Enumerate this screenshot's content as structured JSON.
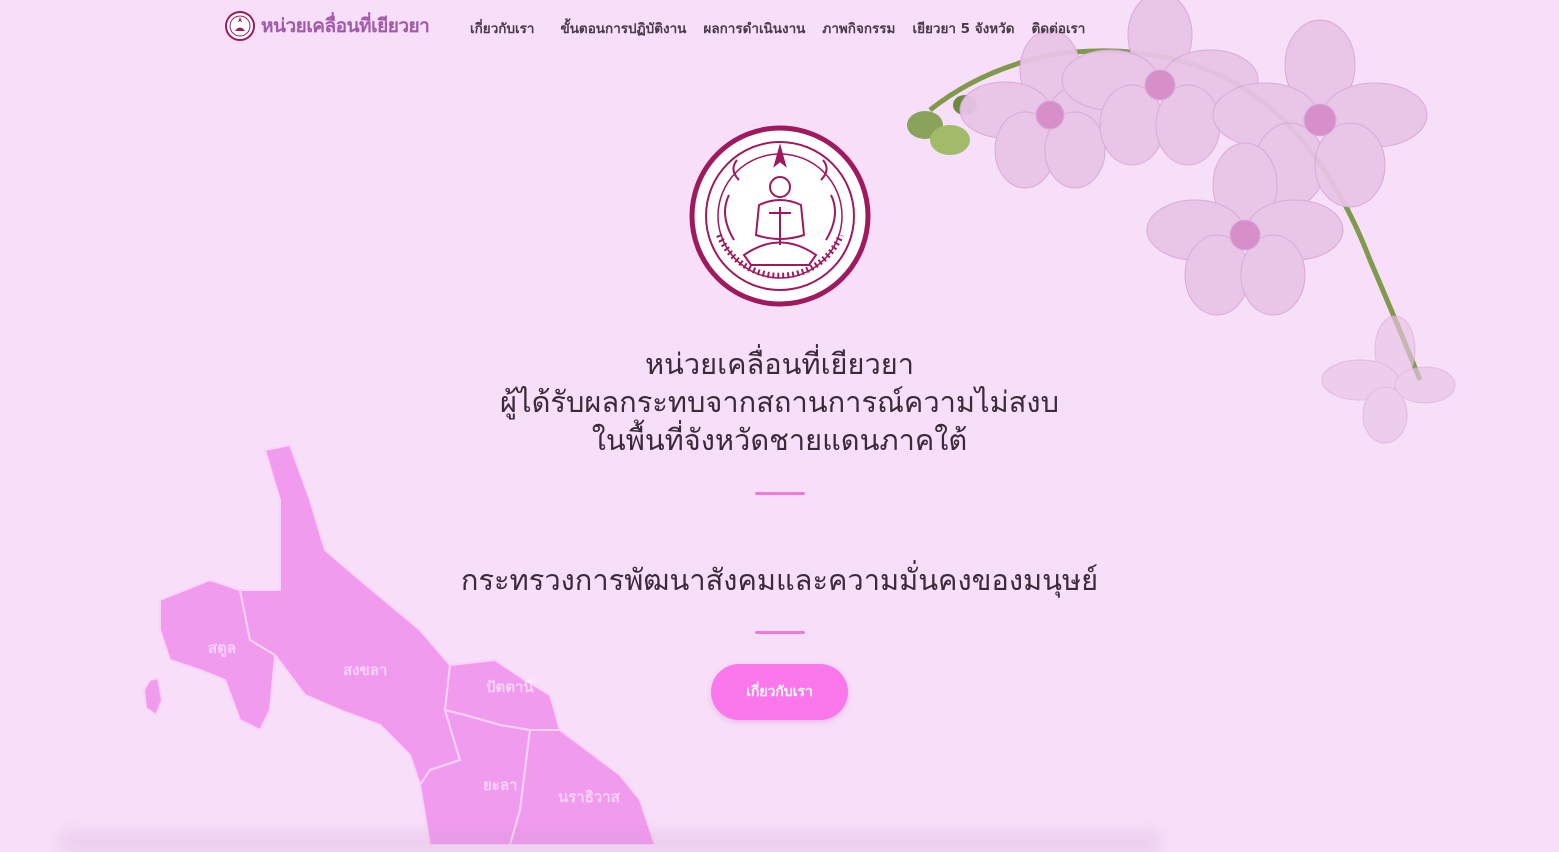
{
  "nav": {
    "brand": "หน่วยเคลื่อนที่เยียวยา",
    "items": [
      {
        "label": "เกี่ยวกับเรา"
      },
      {
        "label": "ขั้นตอนการปฏิบัติงาน"
      },
      {
        "label": "ผลการดำเนินงาน"
      },
      {
        "label": "ภาพกิจกรรม"
      },
      {
        "label": "เยียวยา 5 จังหวัด"
      },
      {
        "label": "ติดต่อเรา"
      }
    ]
  },
  "hero": {
    "title_lines": [
      "หน่วยเคลื่อนที่เยียวยา",
      "ผู้ได้รับผลกระทบจากสถานการณ์ความไม่สงบ",
      "ในพื้นที่จังหวัดชายแดนภาคใต้"
    ],
    "ministry": "กระทรวงการพัฒนาสังคมและความมั่นคงของมนุษย์",
    "cta_label": "เกี่ยวกับเรา"
  },
  "map": {
    "provinces": [
      "สตูล",
      "สงขลา",
      "ปัตตานี",
      "ยะลา",
      "นราธิวาส"
    ]
  },
  "colors": {
    "background": "#f7dff9",
    "accent": "#fb77ec",
    "brand": "#a15aa8",
    "map_fill": "#f19bef",
    "seal": "#a0195f"
  }
}
